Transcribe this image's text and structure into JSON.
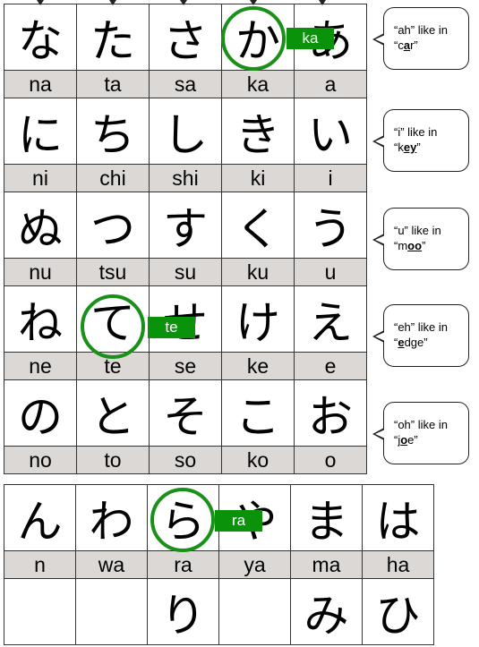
{
  "top_table": [
    {
      "kana": [
        "な",
        "た",
        "さ",
        "か",
        "あ"
      ],
      "romaji": [
        "na",
        "ta",
        "sa",
        "ka",
        "a"
      ]
    },
    {
      "kana": [
        "に",
        "ち",
        "し",
        "き",
        "い"
      ],
      "romaji": [
        "ni",
        "chi",
        "shi",
        "ki",
        "i"
      ]
    },
    {
      "kana": [
        "ぬ",
        "つ",
        "す",
        "く",
        "う"
      ],
      "romaji": [
        "nu",
        "tsu",
        "su",
        "ku",
        "u"
      ]
    },
    {
      "kana": [
        "ね",
        "て",
        "せ",
        "け",
        "え"
      ],
      "romaji": [
        "ne",
        "te",
        "se",
        "ke",
        "e"
      ]
    },
    {
      "kana": [
        "の",
        "と",
        "そ",
        "こ",
        "お"
      ],
      "romaji": [
        "no",
        "to",
        "so",
        "ko",
        "o"
      ]
    }
  ],
  "bottom_table": [
    {
      "kana": [
        "ん",
        "わ",
        "ら",
        "や",
        "ま",
        "は"
      ],
      "romaji": [
        "n",
        "wa",
        "ra",
        "ya",
        "ma",
        "ha"
      ]
    },
    {
      "kana": [
        "",
        "",
        "り",
        "",
        "み",
        "ひ"
      ]
    }
  ],
  "highlights": [
    {
      "label": "ka"
    },
    {
      "label": "te"
    },
    {
      "label": "ra"
    }
  ],
  "bubbles": [
    {
      "pre": "“ah” like in",
      "open": "“c",
      "bold": "a",
      "rest": "r”"
    },
    {
      "pre": "“i” like in",
      "open": "“k",
      "bold": "ey",
      "rest": "”"
    },
    {
      "pre": "“u” like in",
      "open": "“m",
      "bold": "oo",
      "rest": "”"
    },
    {
      "pre": "“eh” like in",
      "open": "“",
      "bold": "e",
      "rest": "dge”"
    },
    {
      "pre": "“oh” like in",
      "open": "“j",
      "bold": "o",
      "rest": "e”"
    }
  ],
  "colors": {
    "highlight": "#0a930a",
    "romaji_bg": "#dcd8d6"
  }
}
